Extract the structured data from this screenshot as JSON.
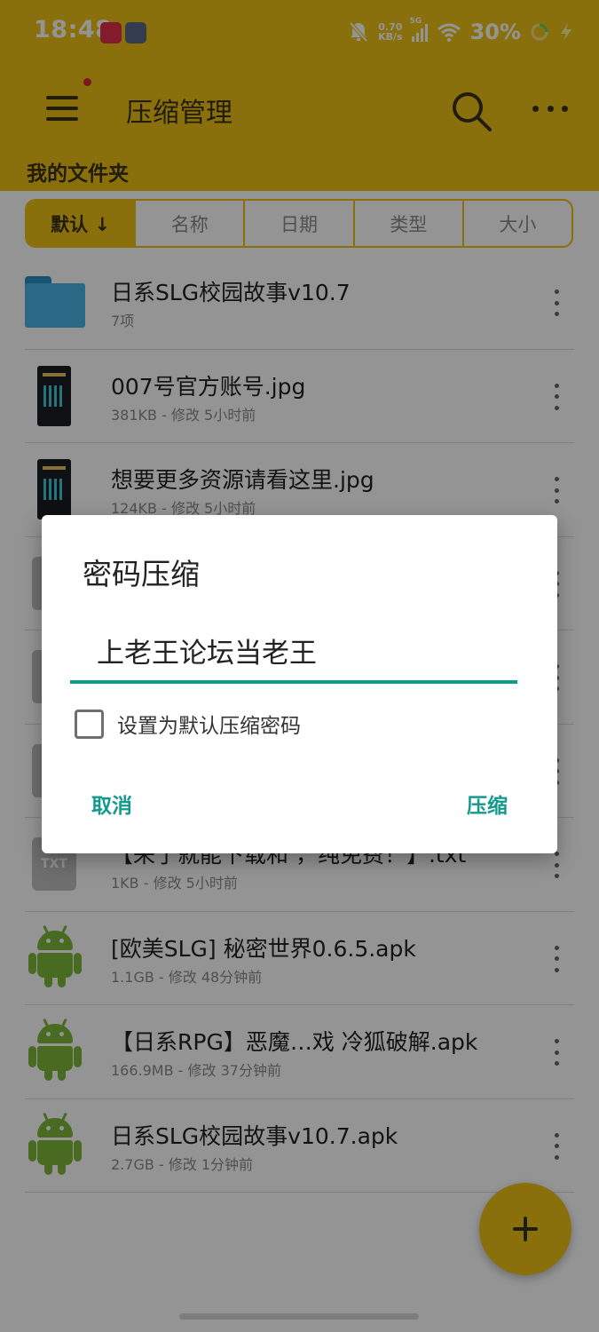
{
  "status_bar": {
    "time": "18:48",
    "net_speed_value": "0.70",
    "net_speed_unit": "KB/s",
    "network_type": "5G",
    "battery": "30%"
  },
  "app_bar": {
    "title": "压缩管理",
    "section_label": "我的文件夹"
  },
  "sort_tabs": [
    {
      "label": "默认 ↓",
      "active": true
    },
    {
      "label": "名称",
      "active": false
    },
    {
      "label": "日期",
      "active": false
    },
    {
      "label": "类型",
      "active": false
    },
    {
      "label": "大小",
      "active": false
    }
  ],
  "files": [
    {
      "name": "日系SLG校园故事v10.7",
      "meta": "7项",
      "icon": "folder-icon"
    },
    {
      "name": "007号官方账号.jpg",
      "meta": "381KB - 修改 5小时前",
      "icon": "image-thumbnail"
    },
    {
      "name": "想要更多资源请看这里.jpg",
      "meta": "124KB - 修改 5小时前",
      "icon": "image-thumbnail"
    },
    {
      "name": "",
      "meta": "",
      "icon": "file-icon"
    },
    {
      "name": "",
      "meta": "",
      "icon": "file-icon"
    },
    {
      "name": "",
      "meta": "",
      "icon": "file-icon"
    },
    {
      "name": "【来了就能下载和   ，纯免费！】.txt",
      "meta": "1KB - 修改 5小时前",
      "icon": "txt-file-icon",
      "thumb_text": "TXT"
    },
    {
      "name": "[欧美SLG] 秘密世界0.6.5.apk",
      "meta": "1.1GB - 修改 48分钟前",
      "icon": "android-apk-icon"
    },
    {
      "name": "【日系RPG】恶魔…戏  冷狐破解.apk",
      "meta": "166.9MB - 修改 37分钟前",
      "icon": "android-apk-icon"
    },
    {
      "name": "日系SLG校园故事v10.7.apk",
      "meta": "2.7GB - 修改 1分钟前",
      "icon": "android-apk-icon"
    }
  ],
  "dialog": {
    "title": "密码压缩",
    "password_value": "上老王论坛当老王",
    "checkbox_label": "设置为默认压缩密码",
    "checkbox_checked": false,
    "cancel_label": "取消",
    "confirm_label": "压缩"
  },
  "colors": {
    "accent": "#ecc216",
    "dialog_accent": "#149a8c"
  }
}
